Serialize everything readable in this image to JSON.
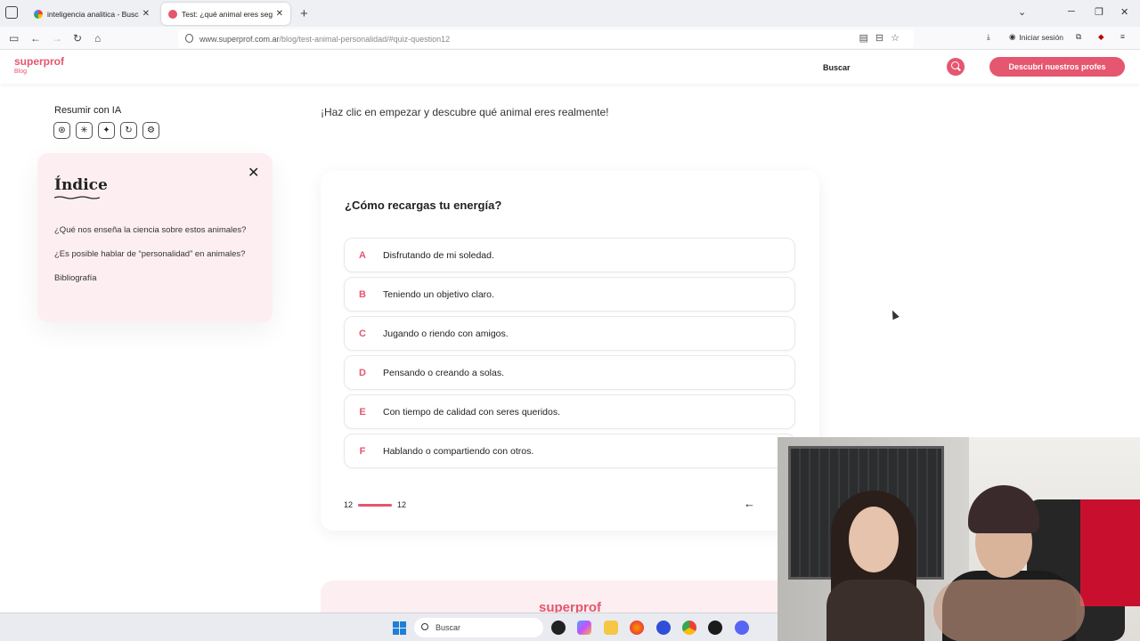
{
  "browser": {
    "tabs": [
      {
        "title": "inteligencia analitica - Buscar co",
        "favicon": "google-icon"
      },
      {
        "title": "Test: ¿qué animal eres según tu",
        "favicon": "superprof-icon",
        "active": true
      }
    ],
    "url_host": "www.superprof.com.ar",
    "url_path": "/blog/test-animal-personalidad/#quiz-question12",
    "signin_label": "Iniciar sesión"
  },
  "header": {
    "logo": "superprof",
    "logo_sub": "Blog",
    "search_label": "Buscar",
    "cta_label": "Descubrí nuestros profes"
  },
  "sidebar": {
    "summarize_label": "Resumir con IA",
    "ai_icons": [
      "chatgpt-icon",
      "claude-icon",
      "gemini-icon",
      "perplexity-icon",
      "grok-icon"
    ],
    "index_title": "Índice",
    "index_links": [
      "¿Qué nos enseña la ciencia sobre estos animales?",
      "¿Es posible hablar de “personalidad” en animales?",
      "Bibliografía"
    ]
  },
  "main": {
    "intro": "¡Haz clic en empezar y descubre qué animal eres realmente!",
    "question": "¿Cómo recargas tu energía?",
    "options": [
      {
        "letter": "A",
        "text": "Disfrutando de mi soledad."
      },
      {
        "letter": "B",
        "text": "Teniendo un objetivo claro."
      },
      {
        "letter": "C",
        "text": "Jugando o riendo con amigos."
      },
      {
        "letter": "D",
        "text": "Pensando o creando a solas."
      },
      {
        "letter": "E",
        "text": "Con tiempo de calidad con seres queridos."
      },
      {
        "letter": "F",
        "text": "Hablando o compartiendo con otros."
      }
    ],
    "progress_current": "12",
    "progress_total": "12",
    "progress_fraction": 1.0,
    "footer_logo": "superprof"
  },
  "taskbar": {
    "search_placeholder": "Buscar"
  },
  "colors": {
    "brand": "#e5566f",
    "index_bg": "#fdeff1"
  }
}
